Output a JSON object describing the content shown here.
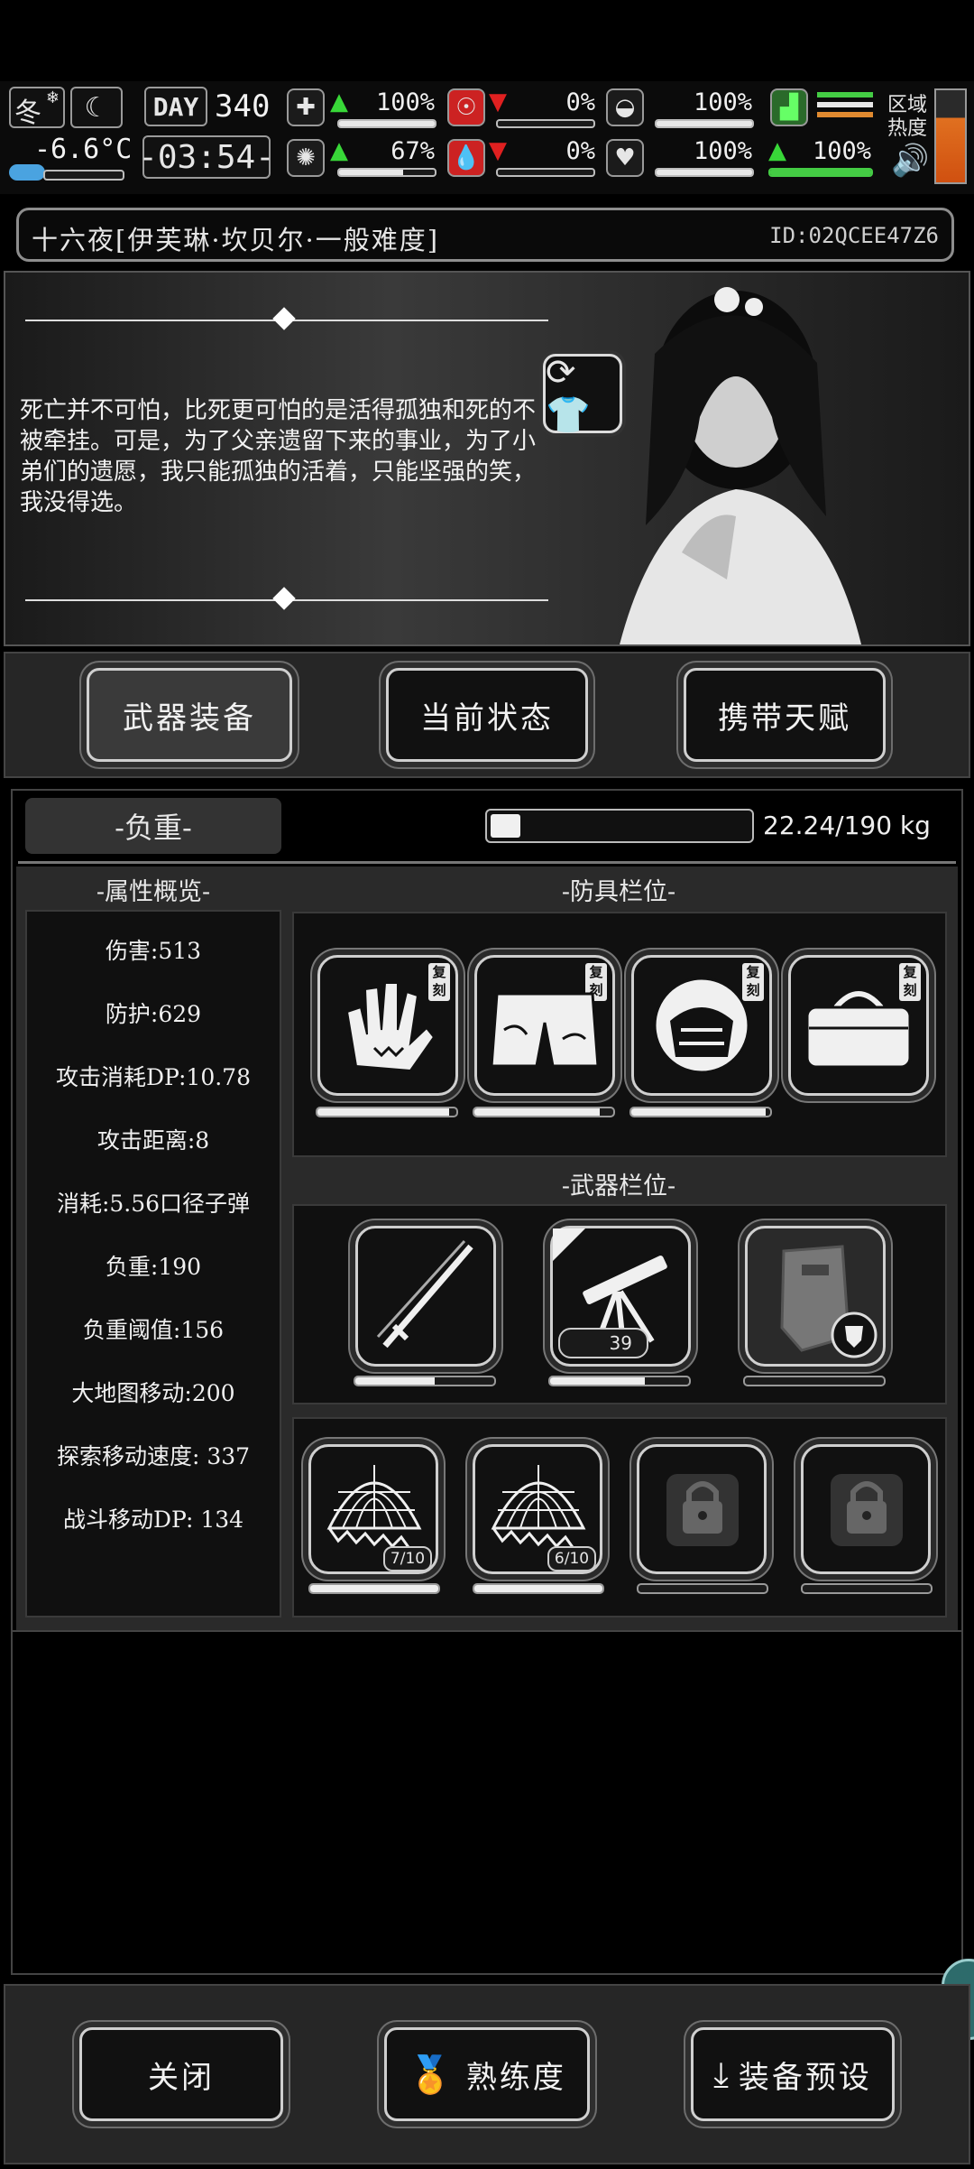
{
  "hud": {
    "season": "冬",
    "temperature": "-6.6°C",
    "day_label": "DAY",
    "day_value": "340",
    "clock": "-03:54-",
    "stats": [
      {
        "name": "health",
        "value": "100%",
        "trend": "up",
        "level": 1.0
      },
      {
        "name": "hunger",
        "value": "0%",
        "trend": "down",
        "level": 0.0
      },
      {
        "name": "stamina",
        "value": "100%",
        "trend": "none",
        "level": 1.0
      },
      {
        "name": "sanity",
        "value": "67%",
        "trend": "up",
        "level": 0.67
      },
      {
        "name": "thirst",
        "value": "0%",
        "trend": "down",
        "level": 0.0
      },
      {
        "name": "mood",
        "value": "100%",
        "trend": "none",
        "level": 1.0
      },
      {
        "name": "speed",
        "value": "100%",
        "trend": "up",
        "level": 1.0
      }
    ],
    "region_heat_label": "区域热度"
  },
  "title": {
    "name": "十六夜[伊芙琳·坎贝尔·一般难度]",
    "id": "ID:02QCEE47Z6"
  },
  "quote": "死亡并不可怕，比死更可怕的是活得孤独和死的不被牵挂。可是，为了父亲遗留下来的事业，为了小弟们的遗愿，我只能孤独的活着，只能坚强的笑，我没得选。",
  "tabs": [
    {
      "label": "武器装备",
      "selected": true
    },
    {
      "label": "当前状态",
      "selected": false
    },
    {
      "label": "携带天赋",
      "selected": false
    }
  ],
  "weight": {
    "label": "-负重-",
    "value": "22.24/190 kg",
    "fraction": 0.117
  },
  "attributes": {
    "title": "-属性概览-",
    "items": [
      "伤害:513",
      "防护:629",
      "攻击消耗DP:10.78",
      "攻击距离:8",
      "消耗:5.56口径子弹",
      "负重:190",
      "负重阈值:156",
      "大地图移动:200",
      "探索移动速度: 337",
      "战斗移动DP: 134"
    ]
  },
  "armor": {
    "title": "-防具栏位-",
    "badge": "复刻",
    "slots": [
      {
        "icon": "gloves-icon",
        "durability": 0.95
      },
      {
        "icon": "shorts-icon",
        "durability": 0.9
      },
      {
        "icon": "helmet-icon",
        "durability": 0.97
      },
      {
        "icon": "bag-icon",
        "durability": null
      }
    ]
  },
  "weapons": {
    "title": "-武器栏位-",
    "slots": [
      {
        "icon": "katana-icon",
        "durability": 0.57
      },
      {
        "icon": "mounted-gun-icon",
        "durability": 0.68,
        "ammo": "39"
      },
      {
        "icon": "riot-shield-icon",
        "durability": null
      }
    ]
  },
  "items": {
    "slots": [
      {
        "icon": "net-trap-icon",
        "count": "7/10",
        "locked": false
      },
      {
        "icon": "net-trap-icon",
        "count": "6/10",
        "locked": false
      },
      {
        "icon": "lock-icon",
        "locked": true
      },
      {
        "icon": "lock-icon",
        "locked": true
      }
    ]
  },
  "footer": {
    "close": "关闭",
    "proficiency": "熟练度",
    "preset": "装备预设"
  }
}
